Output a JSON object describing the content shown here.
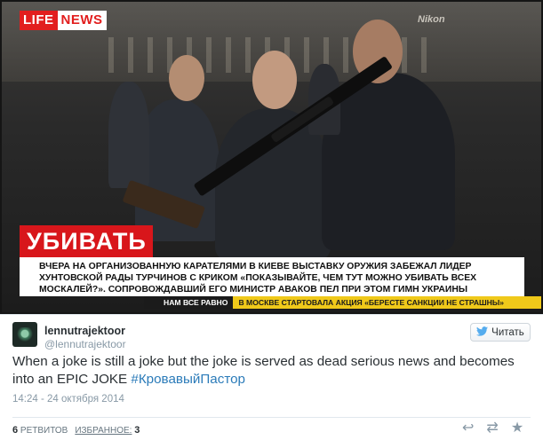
{
  "media": {
    "channel_logo": {
      "part1": "LIFE",
      "part2": "NEWS"
    },
    "sign_text": "Nikon",
    "headline_tag": "УБИВАТЬ",
    "caption_lines": [
      "ВЧЕРА НА ОРГАНИЗОВАННУЮ КАРАТЕЛЯМИ В КИЕВЕ ВЫСТАВКУ ОРУЖИЯ ЗАБЕЖАЛ ЛИДЕР",
      "ХУНТОВСКОЙ РАДЫ ТУРЧИНОВ С КРИКОМ «ПОКАЗЫВАЙТЕ, ЧЕМ ТУТ МОЖНО УБИВАТЬ ВСЕХ",
      "МОСКАЛЕЙ?». СОПРОВОЖДАВШИЙ ЕГО МИНИСТР АВАКОВ ПЕЛ ПРИ ЭТОМ ГИМН УКРАИНЫ"
    ],
    "ticker_left": "НАМ ВСЕ РАВНО",
    "ticker_right": "В МОСКВЕ СТАРТОВАЛА АКЦИЯ «БЕРЕСТЕ САНКЦИИ НЕ СТРАШНЫ»"
  },
  "tweet": {
    "user_name": "lennutrajektoor",
    "user_handle": "@lennutrajektoor",
    "follow_label": "Читать",
    "text_main": "When a joke is still a joke but the joke is served as dead serious news and becomes into an EPIC JOKE ",
    "hashtag": "#КровавыйПастор",
    "timestamp": "14:24 - 24 октября 2014",
    "retweet_count": "6",
    "retweet_label": "РЕТВИТОВ",
    "favorite_label": "ИЗБРАННОЕ:",
    "favorite_count": "3"
  },
  "icons": {
    "follow": "bird-icon",
    "actions": [
      "reply-icon",
      "retweet-icon",
      "favorite-icon"
    ]
  },
  "colors": {
    "accent_red": "#d8161b",
    "ticker_yellow": "#f0c91a",
    "link_blue": "#2b7bb9",
    "twitter_blue": "#55acee",
    "muted_gray": "#8899a6"
  }
}
